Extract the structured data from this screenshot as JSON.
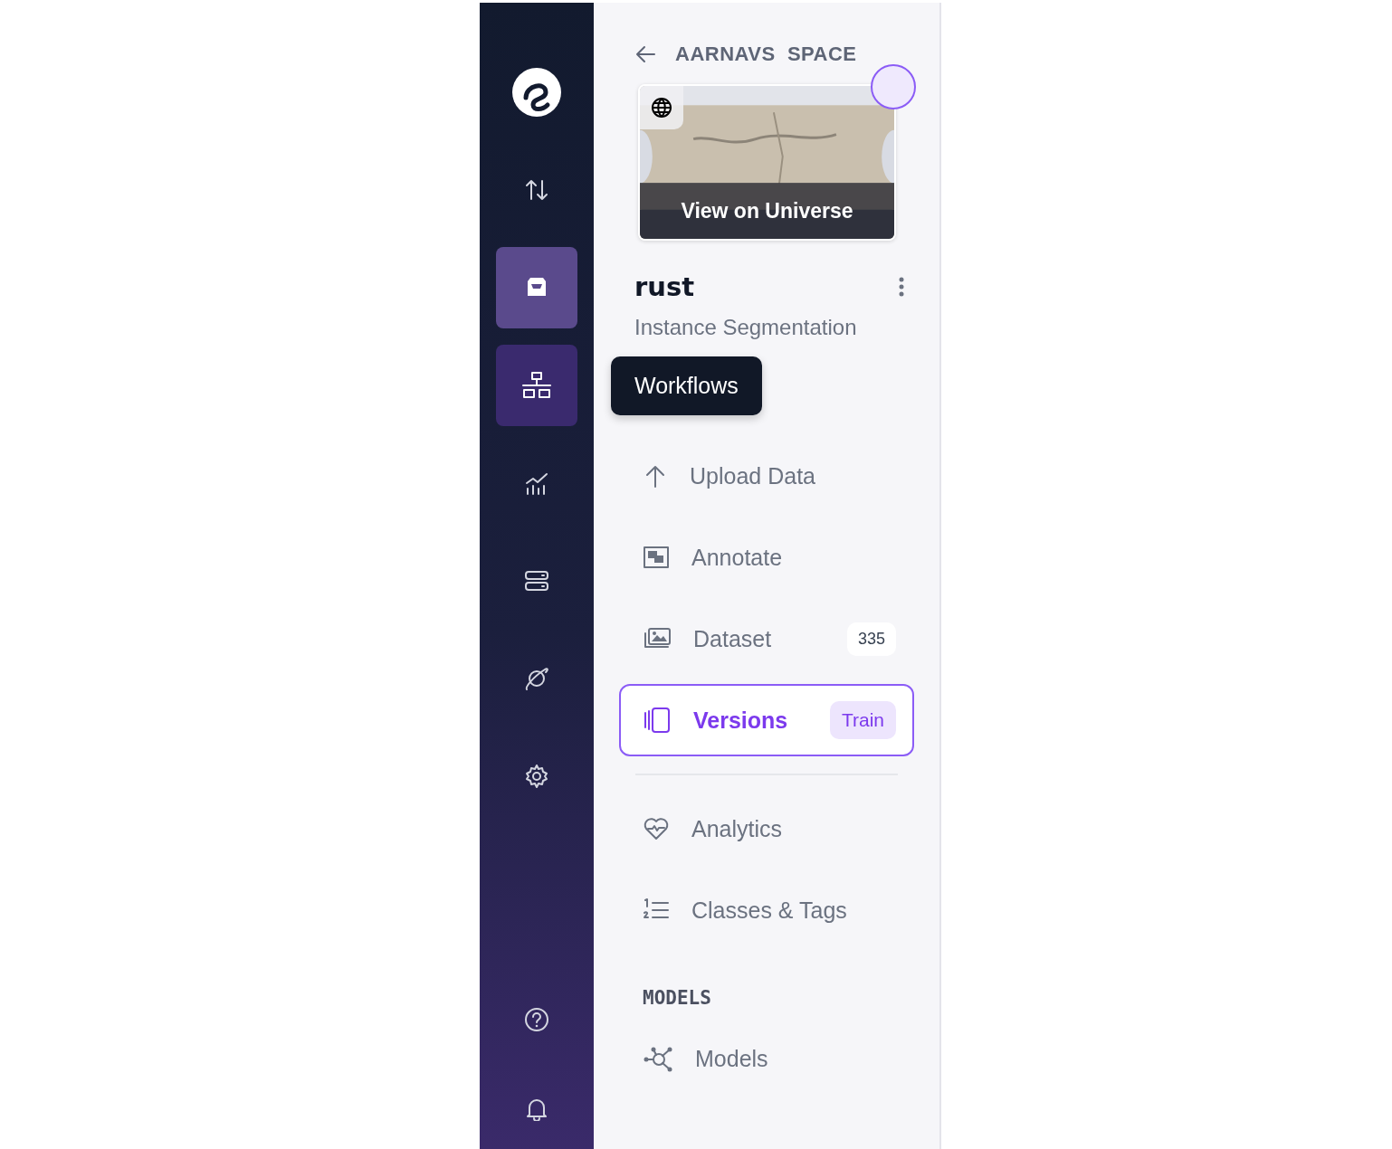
{
  "rail": [
    {
      "selected": false,
      "hovered": false
    },
    {
      "selected": true,
      "hovered": false
    },
    {
      "selected": false,
      "hovered": true
    },
    {
      "selected": false,
      "hovered": false
    },
    {
      "selected": false,
      "hovered": false
    },
    {
      "selected": false,
      "hovered": false
    },
    {
      "selected": false,
      "hovered": false
    }
  ],
  "tooltip": {
    "text": "Workflows"
  },
  "back": {
    "label": "AARNAVS  SPACE"
  },
  "project_card": {
    "overlay": "View on Universe"
  },
  "project": {
    "name": "rust",
    "type": "Instance Segmentation"
  },
  "sections": [
    {
      "items": [
        {
          "kind": "link",
          "label": "Upload Data",
          "selected": false
        },
        {
          "kind": "link",
          "label": "Annotate",
          "selected": false
        },
        {
          "kind": "link",
          "label": "Dataset",
          "badge": "335",
          "selected": false
        },
        {
          "kind": "link",
          "label": "Versions",
          "tag": "Train",
          "selected": true
        },
        {
          "kind": "divider"
        },
        {
          "kind": "link",
          "label": "Analytics",
          "selected": false
        },
        {
          "kind": "link",
          "label": "Classes & Tags",
          "selected": false
        }
      ]
    },
    {
      "heading": "MODELS",
      "items": [
        {
          "kind": "link",
          "label": "Models",
          "selected": false
        }
      ]
    }
  ]
}
